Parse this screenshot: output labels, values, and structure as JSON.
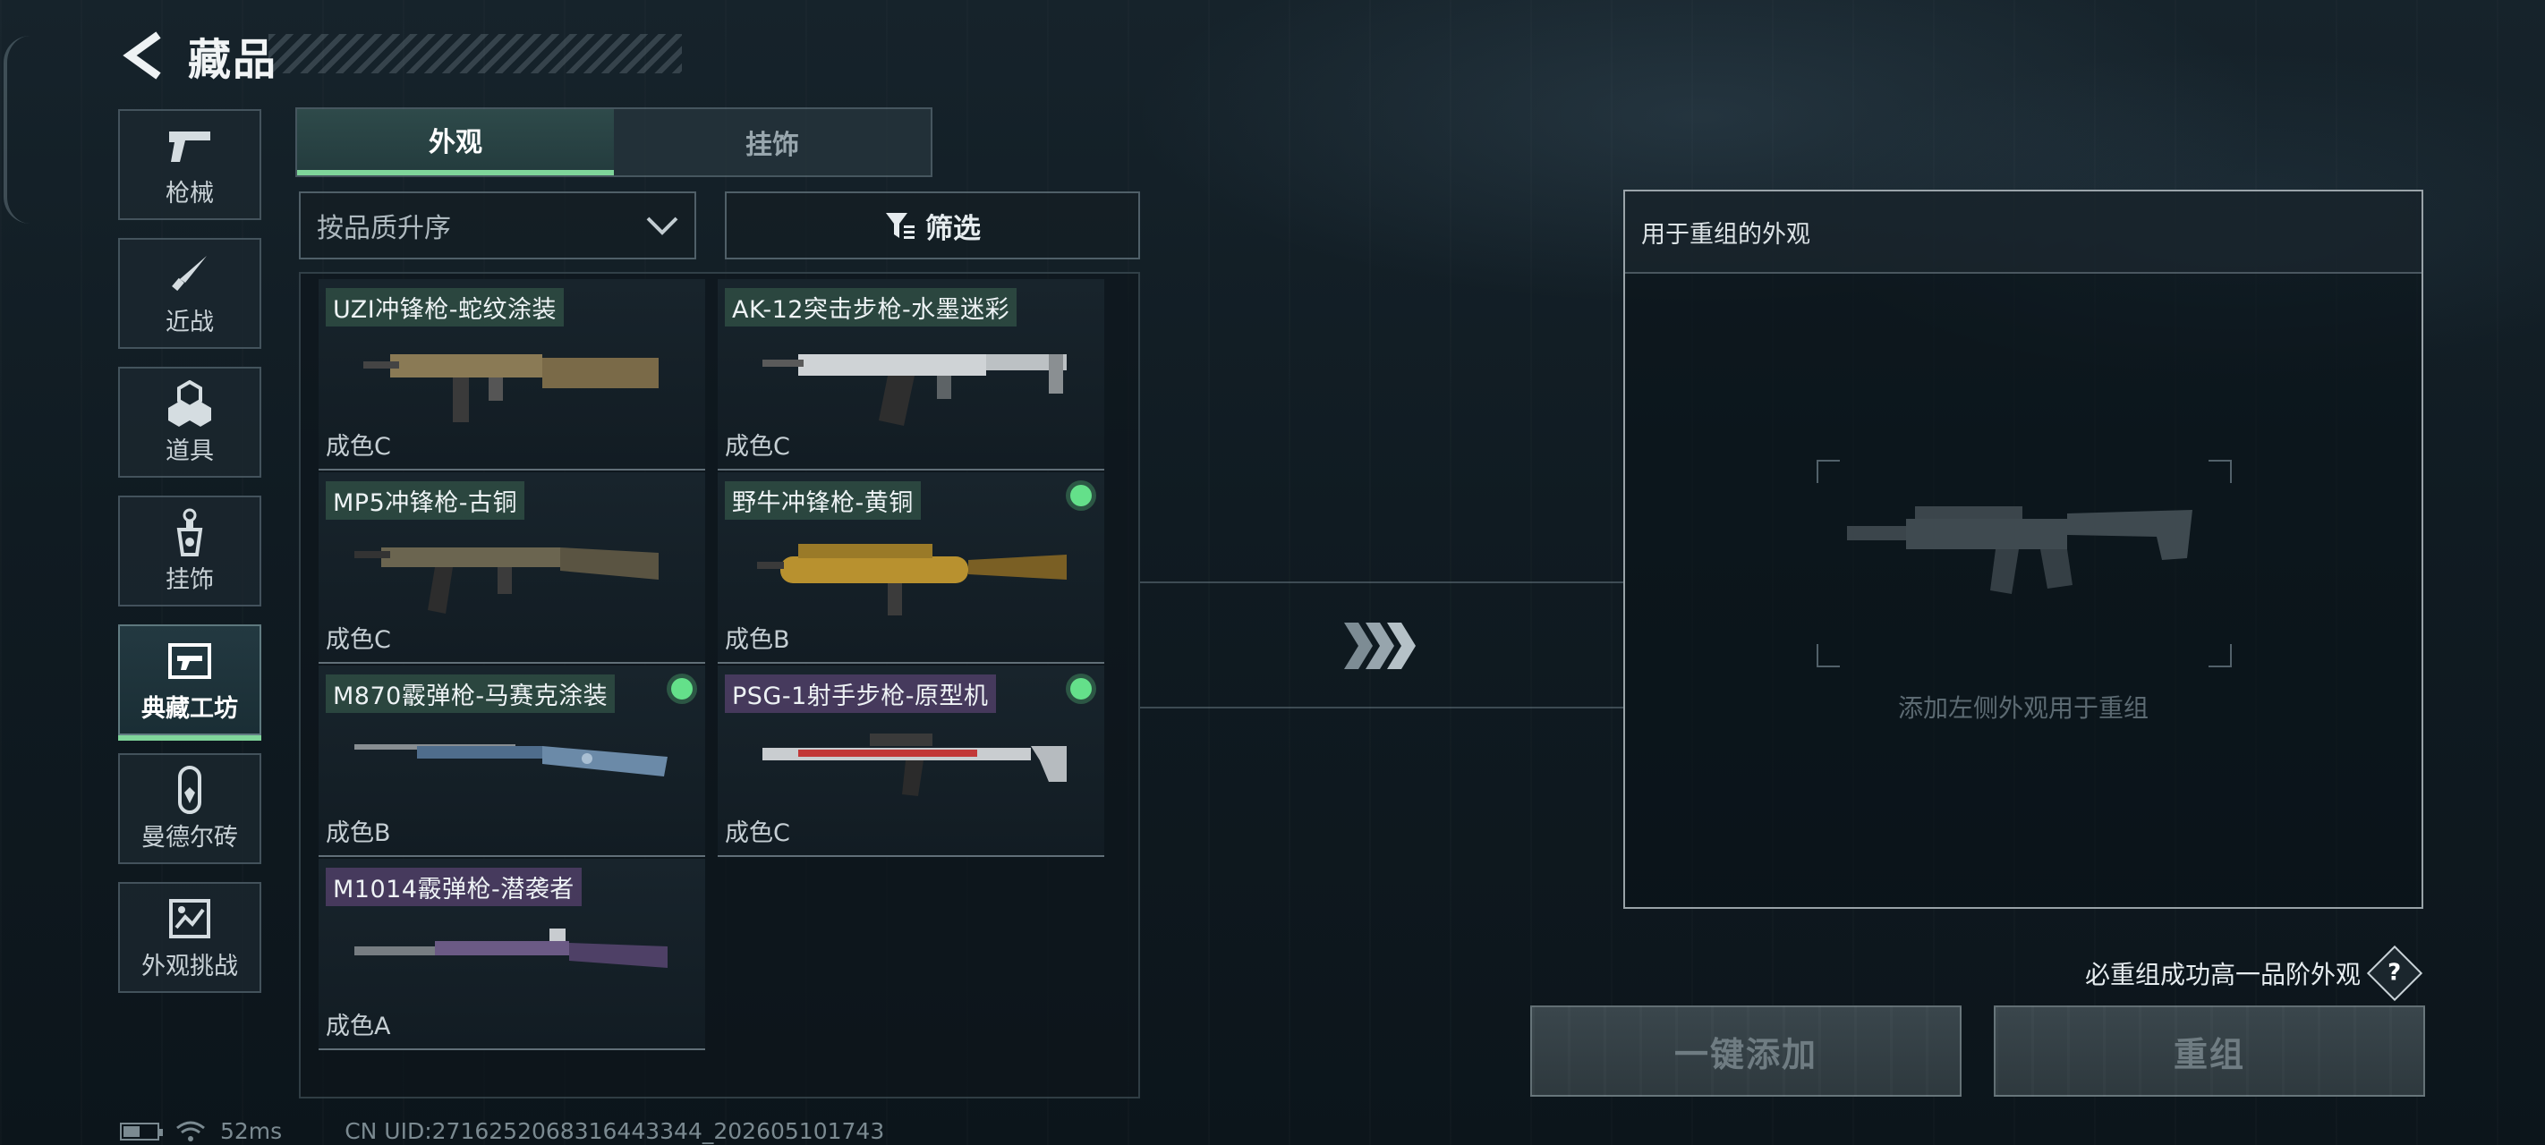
{
  "header": {
    "title": "藏品"
  },
  "sidebar": {
    "items": [
      {
        "label": "枪械",
        "icon": "pistol-icon"
      },
      {
        "label": "近战",
        "icon": "knife-icon"
      },
      {
        "label": "道具",
        "icon": "grenade-icon"
      },
      {
        "label": "挂饰",
        "icon": "charm-icon"
      },
      {
        "label": "典藏工坊",
        "icon": "workshop-icon",
        "active": true
      },
      {
        "label": "曼德尔砖",
        "icon": "brick-icon"
      },
      {
        "label": "外观挑战",
        "icon": "challenge-icon"
      }
    ]
  },
  "tabs": [
    {
      "label": "外观",
      "active": true
    },
    {
      "label": "挂饰",
      "active": false
    }
  ],
  "sort": {
    "value": "按品质升序"
  },
  "filter": {
    "label": "筛选"
  },
  "skins": [
    {
      "name": "UZI冲锋枪-蛇纹涂装",
      "grade": "成色C",
      "tint": "green",
      "selected": false,
      "gun_color": "#8a7a55"
    },
    {
      "name": "AK-12突击步枪-水墨迷彩",
      "grade": "成色C",
      "tint": "green",
      "selected": false,
      "gun_color": "#cfd3d6"
    },
    {
      "name": "MP5冲锋枪-古铜",
      "grade": "成色C",
      "tint": "green",
      "selected": false,
      "gun_color": "#6b6550"
    },
    {
      "name": "野牛冲锋枪-黄铜",
      "grade": "成色B",
      "tint": "green",
      "selected": true,
      "gun_color": "#b8912f"
    },
    {
      "name": "M870霰弹枪-马赛克涂装",
      "grade": "成色B",
      "tint": "green",
      "selected": true,
      "gun_color": "#4f6d8c"
    },
    {
      "name": "PSG-1射手步枪-原型机",
      "grade": "成色C",
      "tint": "purple",
      "selected": true,
      "gun_color": "#c23838"
    },
    {
      "name": "M1014霰弹枪-潜袭者",
      "grade": "成色A",
      "tint": "purple",
      "selected": false,
      "gun_color": "#6b5a85"
    }
  ],
  "remix": {
    "title": "用于重组的外观",
    "hint": "添加左侧外观用于重组",
    "guarantee": "必重组成功高一品阶外观",
    "help": "?",
    "add_all_label": "一键添加",
    "remix_label": "重组"
  },
  "status": {
    "ping": "52ms",
    "uid": "CN UID:2716252068316443344_202605101743"
  },
  "colors": {
    "accent_green": "#7fd59a",
    "selected_dot": "#64e08a",
    "tint_purple": "#5f4678"
  }
}
